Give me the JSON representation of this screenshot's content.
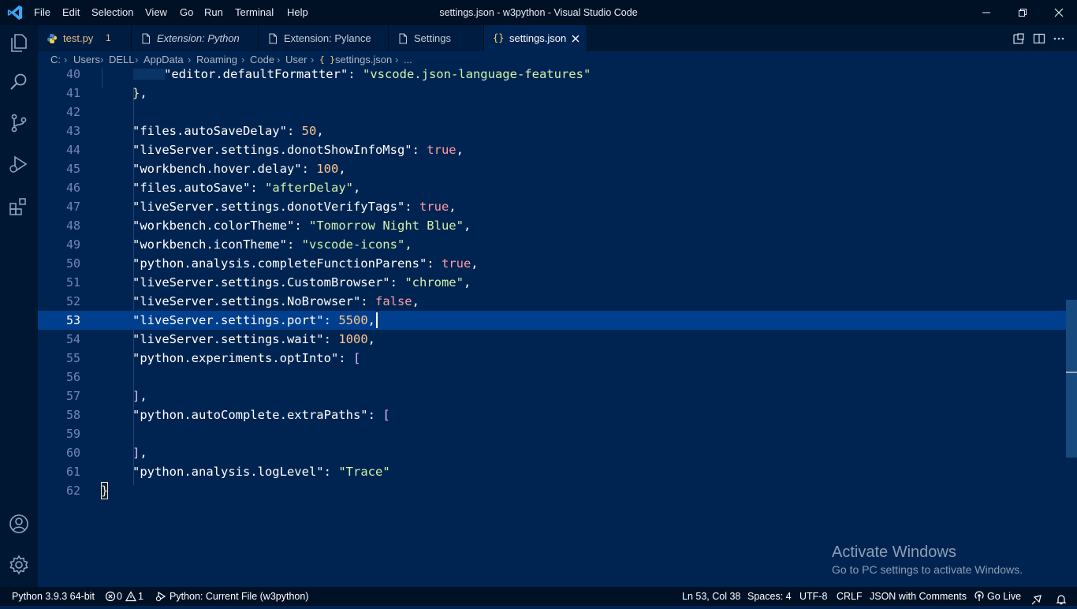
{
  "window": {
    "title": "settings.json - w3python - Visual Studio Code",
    "menu": [
      "File",
      "Edit",
      "Selection",
      "View",
      "Go",
      "Run",
      "Terminal",
      "Help"
    ]
  },
  "tabs": [
    {
      "label": "test.py",
      "badge": "1",
      "icon": "python-icon",
      "active": false
    },
    {
      "label": "Extension: Python",
      "icon": "document-icon",
      "italic": true
    },
    {
      "label": "Extension: Pylance",
      "icon": "document-icon"
    },
    {
      "label": "Settings",
      "icon": "document-icon"
    },
    {
      "label": "settings.json",
      "icon": "json-braces-icon",
      "active": true
    }
  ],
  "breadcrumb": [
    "C:",
    "Users",
    "DELL",
    "AppData",
    "Roaming",
    "Code",
    "User",
    "settings.json",
    "..."
  ],
  "breadcrumb_icon": "{ }",
  "editor": {
    "current_line": 53,
    "lines": [
      {
        "n": "40",
        "code": "\"editor.defaultFormatter\": \"vscode.json-language-features\""
      },
      {
        "n": "41",
        "code": "},"
      },
      {
        "n": "42",
        "code": ""
      },
      {
        "n": "43",
        "code": "\"files.autoSaveDelay\": 50,"
      },
      {
        "n": "44",
        "code": "\"liveServer.settings.donotShowInfoMsg\": true,"
      },
      {
        "n": "45",
        "code": "\"workbench.hover.delay\": 100,"
      },
      {
        "n": "46",
        "code": "\"files.autoSave\": \"afterDelay\","
      },
      {
        "n": "47",
        "code": "\"liveServer.settings.donotVerifyTags\": true,"
      },
      {
        "n": "48",
        "code": "\"workbench.colorTheme\": \"Tomorrow Night Blue\","
      },
      {
        "n": "49",
        "code": "\"workbench.iconTheme\": \"vscode-icons\","
      },
      {
        "n": "50",
        "code": "\"python.analysis.completeFunctionParens\": true,"
      },
      {
        "n": "51",
        "code": "\"liveServer.settings.CustomBrowser\": \"chrome\","
      },
      {
        "n": "52",
        "code": "\"liveServer.settings.NoBrowser\": false,"
      },
      {
        "n": "53",
        "code": "\"liveServer.settings.port\": 5500,"
      },
      {
        "n": "54",
        "code": "\"liveServer.settings.wait\": 1000,"
      },
      {
        "n": "55",
        "code": "\"python.experiments.optInto\": ["
      },
      {
        "n": "56",
        "code": ""
      },
      {
        "n": "57",
        "code": "],"
      },
      {
        "n": "58",
        "code": "\"python.autoComplete.extraPaths\": ["
      },
      {
        "n": "59",
        "code": ""
      },
      {
        "n": "60",
        "code": "],"
      },
      {
        "n": "61",
        "code": "\"python.analysis.logLevel\": \"Trace\""
      },
      {
        "n": "62",
        "code": "}"
      }
    ]
  },
  "watermark": {
    "title": "Activate Windows",
    "subtitle": "Go to PC settings to activate Windows."
  },
  "statusbar": {
    "interpreter": "Python 3.9.3 64-bit",
    "errors": "0",
    "warnings": "1",
    "run_config": "Python: Current File (w3python)",
    "position": "Ln 53, Col 38",
    "indent": "Spaces: 4",
    "encoding": "UTF-8",
    "eol": "CRLF",
    "language": "JSON with Comments",
    "golive": "Go Live"
  },
  "colors": {
    "editor_bg": "#002451",
    "titlebar_bg": "#001126",
    "activitybar_bg": "#001733",
    "string": "#d1f1a9",
    "number": "#ffc58f",
    "boolean": "#ff9da4",
    "line_number": "#7285b7",
    "current_line_bg": "#003f8e"
  }
}
